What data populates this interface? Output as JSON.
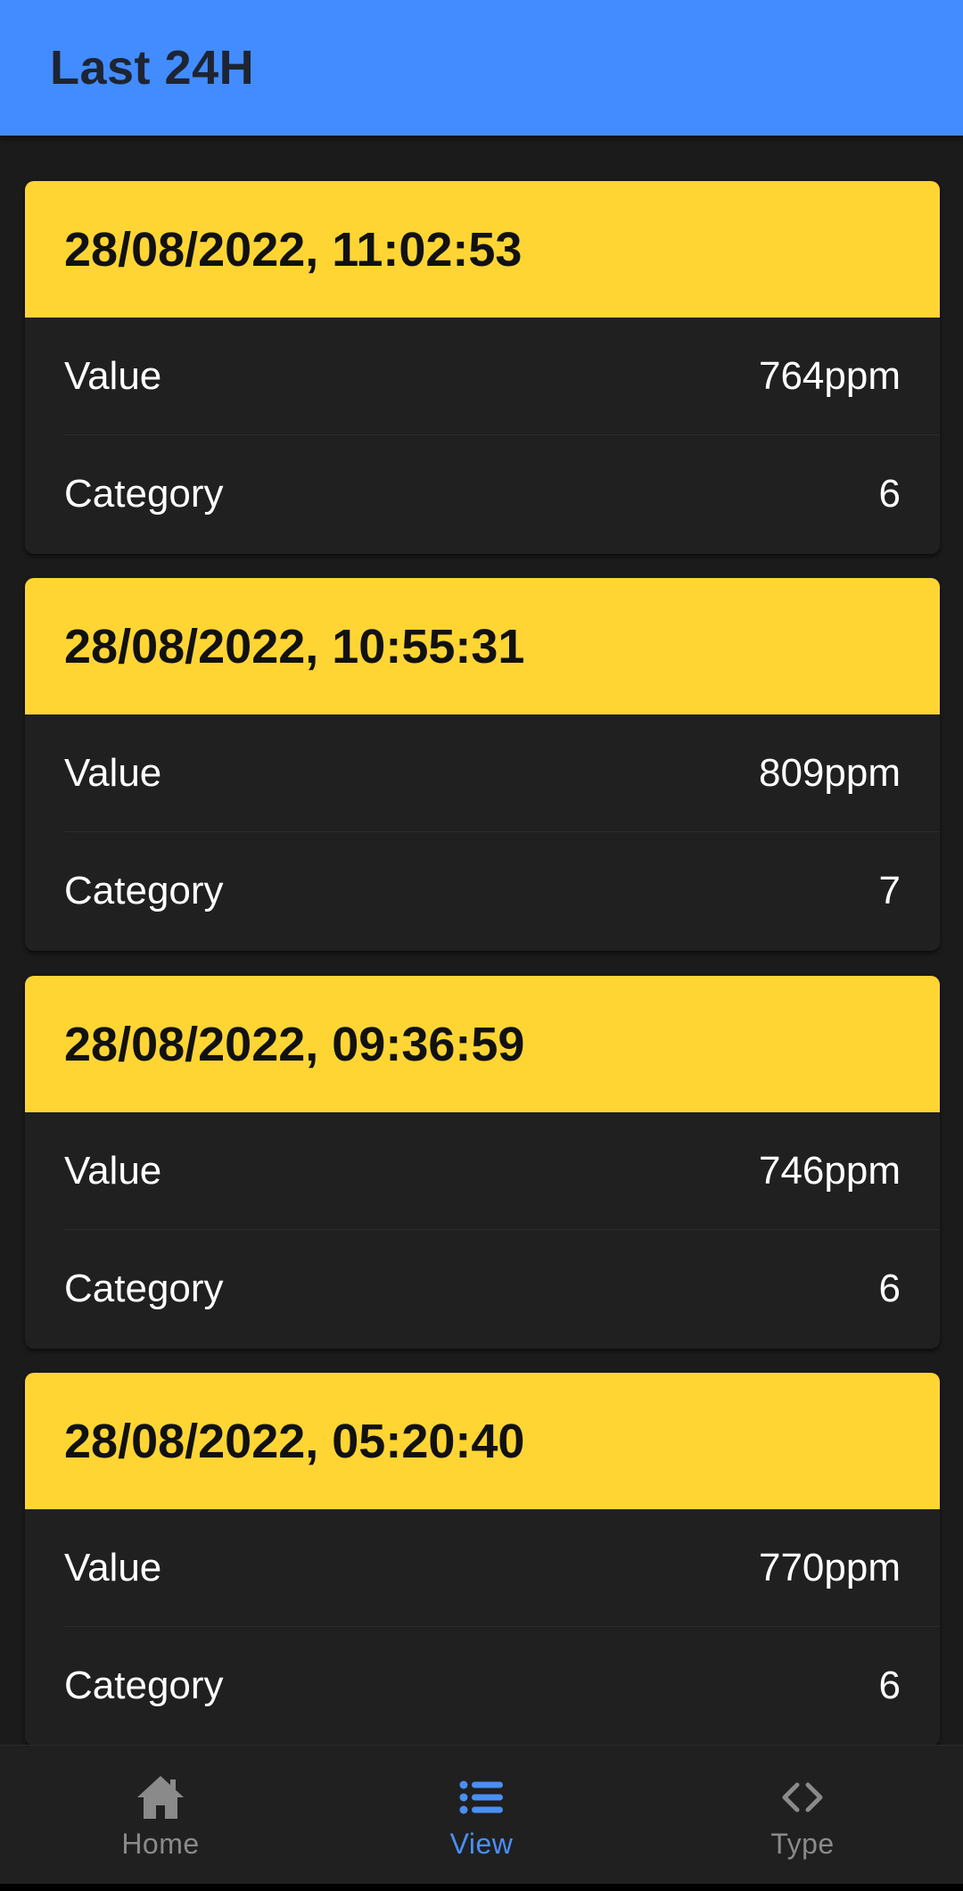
{
  "app_bar": {
    "title": "Last 24H"
  },
  "readings": [
    {
      "timestamp": "28/08/2022, 11:02:53",
      "value_label": "Value",
      "value": "764ppm",
      "category_label": "Category",
      "category": "6"
    },
    {
      "timestamp": "28/08/2022, 10:55:31",
      "value_label": "Value",
      "value": "809ppm",
      "category_label": "Category",
      "category": "7"
    },
    {
      "timestamp": "28/08/2022, 09:36:59",
      "value_label": "Value",
      "value": "746ppm",
      "category_label": "Category",
      "category": "6"
    },
    {
      "timestamp": "28/08/2022, 05:20:40",
      "value_label": "Value",
      "value": "770ppm",
      "category_label": "Category",
      "category": "6"
    }
  ],
  "tabs": [
    {
      "label": "Home",
      "icon": "home-icon",
      "active": false
    },
    {
      "label": "View",
      "icon": "list-icon",
      "active": true
    },
    {
      "label": "Type",
      "icon": "code-icon",
      "active": false
    }
  ],
  "colors": {
    "app_bar": "#428cff",
    "card_header": "#ffd534",
    "background": "#1b1b1b",
    "card_body": "#202020",
    "tab_active": "#4a8ff5",
    "tab_inactive": "#8a8a8a"
  }
}
